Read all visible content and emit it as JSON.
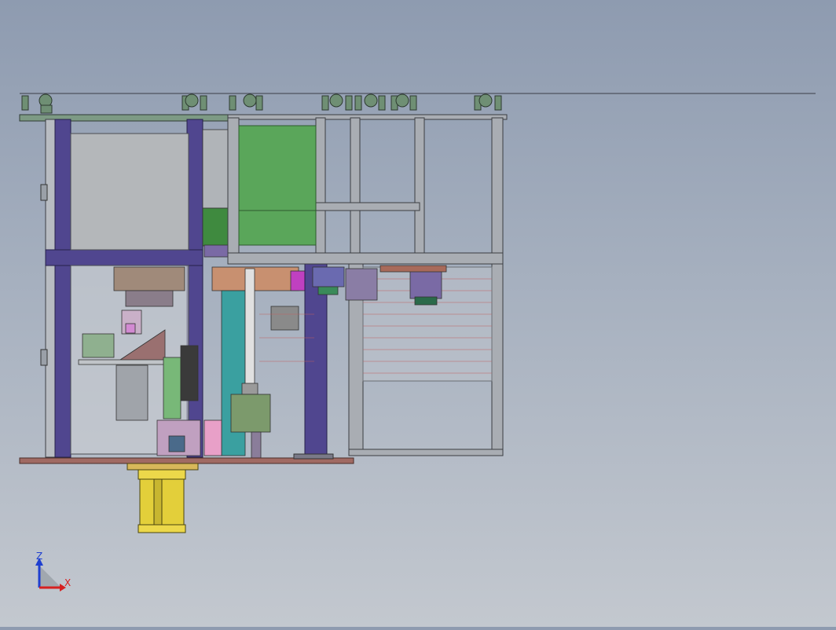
{
  "triad": {
    "z_label": "Z",
    "x_label": "X",
    "z_color": "#1f3fd0",
    "x_color": "#d62020"
  },
  "colors": {
    "background_top": "#8e9bb0",
    "background_bottom": "#c3c8cf",
    "frame_purple": "#50468f",
    "aluminum_gray": "#a9adb3",
    "panel_green": "#5aa65a",
    "sheet_gray": "#b4b7ba",
    "cylinder_yellow": "#e3cf3a",
    "base_plate": "#a06a63"
  }
}
